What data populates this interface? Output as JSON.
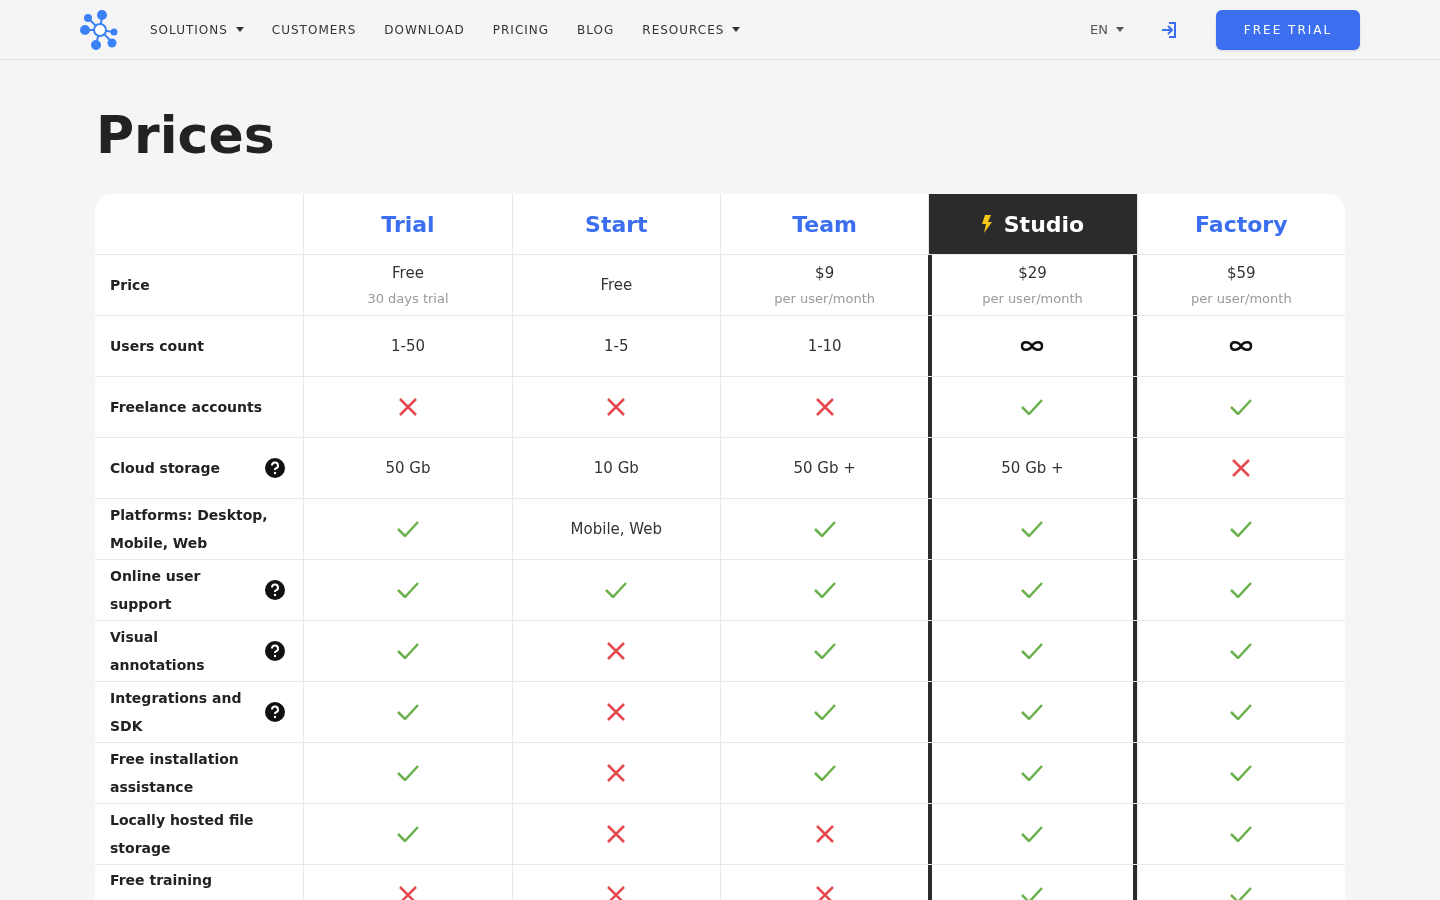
{
  "nav": {
    "items": [
      {
        "label": "SOLUTIONS",
        "dropdown": true
      },
      {
        "label": "CUSTOMERS",
        "dropdown": false
      },
      {
        "label": "DOWNLOAD",
        "dropdown": false
      },
      {
        "label": "PRICING",
        "dropdown": false
      },
      {
        "label": "BLOG",
        "dropdown": false
      },
      {
        "label": "RESOURCES",
        "dropdown": true
      }
    ],
    "language": "EN",
    "cta": "FREE TRIAL"
  },
  "title": "Prices",
  "plans": [
    {
      "name": "Trial",
      "highlighted": false
    },
    {
      "name": "Start",
      "highlighted": false
    },
    {
      "name": "Team",
      "highlighted": false
    },
    {
      "name": "Studio",
      "highlighted": true
    },
    {
      "name": "Factory",
      "highlighted": false
    }
  ],
  "rows": [
    {
      "label": "Price",
      "help": false,
      "cells": [
        {
          "kind": "text",
          "value": "Free",
          "note": "30 days trial"
        },
        {
          "kind": "text",
          "value": "Free"
        },
        {
          "kind": "text",
          "value": "$9",
          "note": "per user/month"
        },
        {
          "kind": "text",
          "value": "$29",
          "note": "per user/month"
        },
        {
          "kind": "text",
          "value": "$59",
          "note": "per user/month"
        }
      ]
    },
    {
      "label": "Users count",
      "help": false,
      "cells": [
        {
          "kind": "text",
          "value": "1-50"
        },
        {
          "kind": "text",
          "value": "1-5"
        },
        {
          "kind": "text",
          "value": "1-10"
        },
        {
          "kind": "unlimited"
        },
        {
          "kind": "unlimited"
        }
      ]
    },
    {
      "label": "Freelance accounts",
      "help": false,
      "cells": [
        {
          "kind": "no"
        },
        {
          "kind": "no"
        },
        {
          "kind": "no"
        },
        {
          "kind": "yes"
        },
        {
          "kind": "yes"
        }
      ]
    },
    {
      "label": "Cloud storage",
      "help": true,
      "cells": [
        {
          "kind": "text",
          "value": "50 Gb"
        },
        {
          "kind": "text",
          "value": "10 Gb"
        },
        {
          "kind": "text",
          "value": "50 Gb +"
        },
        {
          "kind": "text",
          "value": "50 Gb +"
        },
        {
          "kind": "no"
        }
      ]
    },
    {
      "label": "Platforms: Desktop, Mobile, Web",
      "help": false,
      "cells": [
        {
          "kind": "yes"
        },
        {
          "kind": "text",
          "value": "Mobile, Web"
        },
        {
          "kind": "yes"
        },
        {
          "kind": "yes"
        },
        {
          "kind": "yes"
        }
      ]
    },
    {
      "label": "Online user support",
      "help": true,
      "cells": [
        {
          "kind": "yes"
        },
        {
          "kind": "yes"
        },
        {
          "kind": "yes"
        },
        {
          "kind": "yes"
        },
        {
          "kind": "yes"
        }
      ]
    },
    {
      "label": "Visual annotations",
      "help": true,
      "cells": [
        {
          "kind": "yes"
        },
        {
          "kind": "no"
        },
        {
          "kind": "yes"
        },
        {
          "kind": "yes"
        },
        {
          "kind": "yes"
        }
      ]
    },
    {
      "label": "Integrations and SDK",
      "help": true,
      "cells": [
        {
          "kind": "yes"
        },
        {
          "kind": "no"
        },
        {
          "kind": "yes"
        },
        {
          "kind": "yes"
        },
        {
          "kind": "yes"
        }
      ]
    },
    {
      "label": "Free installation assistance",
      "help": false,
      "cells": [
        {
          "kind": "yes"
        },
        {
          "kind": "no"
        },
        {
          "kind": "yes"
        },
        {
          "kind": "yes"
        },
        {
          "kind": "yes"
        }
      ]
    },
    {
      "label": "Locally hosted file storage",
      "help": false,
      "cells": [
        {
          "kind": "yes"
        },
        {
          "kind": "no"
        },
        {
          "kind": "no"
        },
        {
          "kind": "yes"
        },
        {
          "kind": "yes"
        }
      ]
    },
    {
      "label": "Free training",
      "help": false,
      "cells": [
        {
          "kind": "no"
        },
        {
          "kind": "no"
        },
        {
          "kind": "no"
        },
        {
          "kind": "yes"
        },
        {
          "kind": "yes"
        }
      ]
    }
  ]
}
